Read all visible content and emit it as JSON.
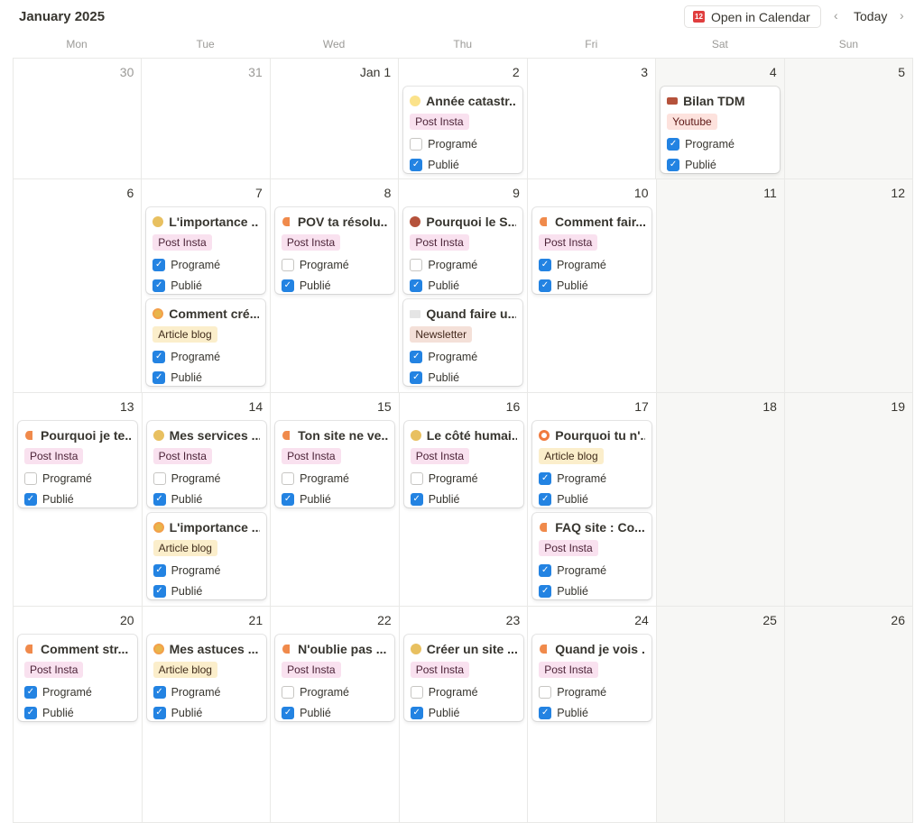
{
  "header": {
    "title": "January 2025",
    "open_label": "Open in Calendar",
    "open_icon": "12",
    "today_label": "Today",
    "prev": "‹",
    "next": "›"
  },
  "weekdays": [
    "Mon",
    "Tue",
    "Wed",
    "Thu",
    "Fri",
    "Sat",
    "Sun"
  ],
  "labels": {
    "programmed": "Programé",
    "published": "Publié"
  },
  "tag_colors": {
    "Post Insta": [
      "#f9e1ef",
      "#4c2337"
    ],
    "Article blog": [
      "#fbeecb",
      "#402c1b"
    ],
    "Newsletter": [
      "#f4e0d8",
      "#44291d"
    ],
    "Youtube": [
      "#fde2dd",
      "#5d1715"
    ]
  },
  "weeks": [
    [
      {
        "d": "30",
        "muted": true
      },
      {
        "d": "31",
        "muted": true
      },
      {
        "d": "Jan 1"
      },
      {
        "d": "2",
        "cards": [
          {
            "icon": "yellow-circle",
            "color": "#fbe28a",
            "title": "Année catastr...",
            "tag": "Post Insta",
            "programmed": false,
            "published": true
          }
        ]
      },
      {
        "d": "3"
      },
      {
        "d": "4",
        "cards": [
          {
            "icon": "camera",
            "title": "Bilan TDM",
            "tag": "Youtube",
            "programmed": true,
            "published": true
          }
        ]
      },
      {
        "d": "5"
      }
    ],
    [
      {
        "d": "6"
      },
      {
        "d": "7",
        "cards": [
          {
            "icon": "yellow-circle",
            "color": "#e8c060",
            "title": "L'importance ...",
            "tag": "Post Insta",
            "programmed": true,
            "published": true
          },
          {
            "icon": "cookie",
            "title": "Comment cré...",
            "tag": "Article blog",
            "programmed": true,
            "published": true
          }
        ]
      },
      {
        "d": "8",
        "cards": [
          {
            "icon": "moon",
            "title": "POV ta résolu...",
            "tag": "Post Insta",
            "programmed": false,
            "published": true
          }
        ]
      },
      {
        "d": "9",
        "cards": [
          {
            "icon": "red-circle",
            "color": "#b5523b",
            "title": "Pourquoi le S...",
            "tag": "Post Insta",
            "programmed": false,
            "published": true
          },
          {
            "icon": "envelope",
            "title": "Quand faire u...",
            "tag": "Newsletter",
            "programmed": true,
            "published": true
          }
        ]
      },
      {
        "d": "10",
        "cards": [
          {
            "icon": "moon",
            "title": "Comment fair...",
            "tag": "Post Insta",
            "programmed": true,
            "published": true
          }
        ]
      },
      {
        "d": "11"
      },
      {
        "d": "12"
      }
    ],
    [
      {
        "d": "13",
        "cards": [
          {
            "icon": "moon",
            "title": "Pourquoi je te...",
            "tag": "Post Insta",
            "programmed": false,
            "published": true
          }
        ]
      },
      {
        "d": "14",
        "cards": [
          {
            "icon": "yellow-circle",
            "color": "#e8c060",
            "title": "Mes services ...",
            "tag": "Post Insta",
            "programmed": false,
            "published": true
          },
          {
            "icon": "cookie",
            "title": "L'importance ...",
            "tag": "Article blog",
            "programmed": true,
            "published": true
          }
        ]
      },
      {
        "d": "15",
        "cards": [
          {
            "icon": "moon",
            "title": "Ton site ne ve...",
            "tag": "Post Insta",
            "programmed": false,
            "published": true
          }
        ]
      },
      {
        "d": "16",
        "cards": [
          {
            "icon": "yellow-circle",
            "color": "#e8c060",
            "title": "Le côté humai...",
            "tag": "Post Insta",
            "programmed": false,
            "published": true
          }
        ]
      },
      {
        "d": "17",
        "cards": [
          {
            "icon": "donut",
            "title": "Pourquoi tu n'...",
            "tag": "Article blog",
            "programmed": true,
            "published": true
          },
          {
            "icon": "moon",
            "title": "FAQ site : Co...",
            "tag": "Post Insta",
            "programmed": true,
            "published": true
          }
        ]
      },
      {
        "d": "18"
      },
      {
        "d": "19"
      }
    ],
    [
      {
        "d": "20",
        "cards": [
          {
            "icon": "moon",
            "title": "Comment str...",
            "tag": "Post Insta",
            "programmed": true,
            "published": true
          }
        ]
      },
      {
        "d": "21",
        "cards": [
          {
            "icon": "cookie",
            "title": "Mes astuces ...",
            "tag": "Article blog",
            "programmed": true,
            "published": true
          }
        ]
      },
      {
        "d": "22",
        "cards": [
          {
            "icon": "moon",
            "title": "N'oublie pas ...",
            "tag": "Post Insta",
            "programmed": false,
            "published": true
          }
        ]
      },
      {
        "d": "23",
        "cards": [
          {
            "icon": "yellow-circle",
            "color": "#e8c060",
            "title": "Créer un site ...",
            "tag": "Post Insta",
            "programmed": false,
            "published": true
          }
        ]
      },
      {
        "d": "24",
        "cards": [
          {
            "icon": "moon",
            "title": "Quand je vois ...",
            "tag": "Post Insta",
            "programmed": false,
            "published": true
          }
        ]
      },
      {
        "d": "25"
      },
      {
        "d": "26"
      }
    ]
  ]
}
